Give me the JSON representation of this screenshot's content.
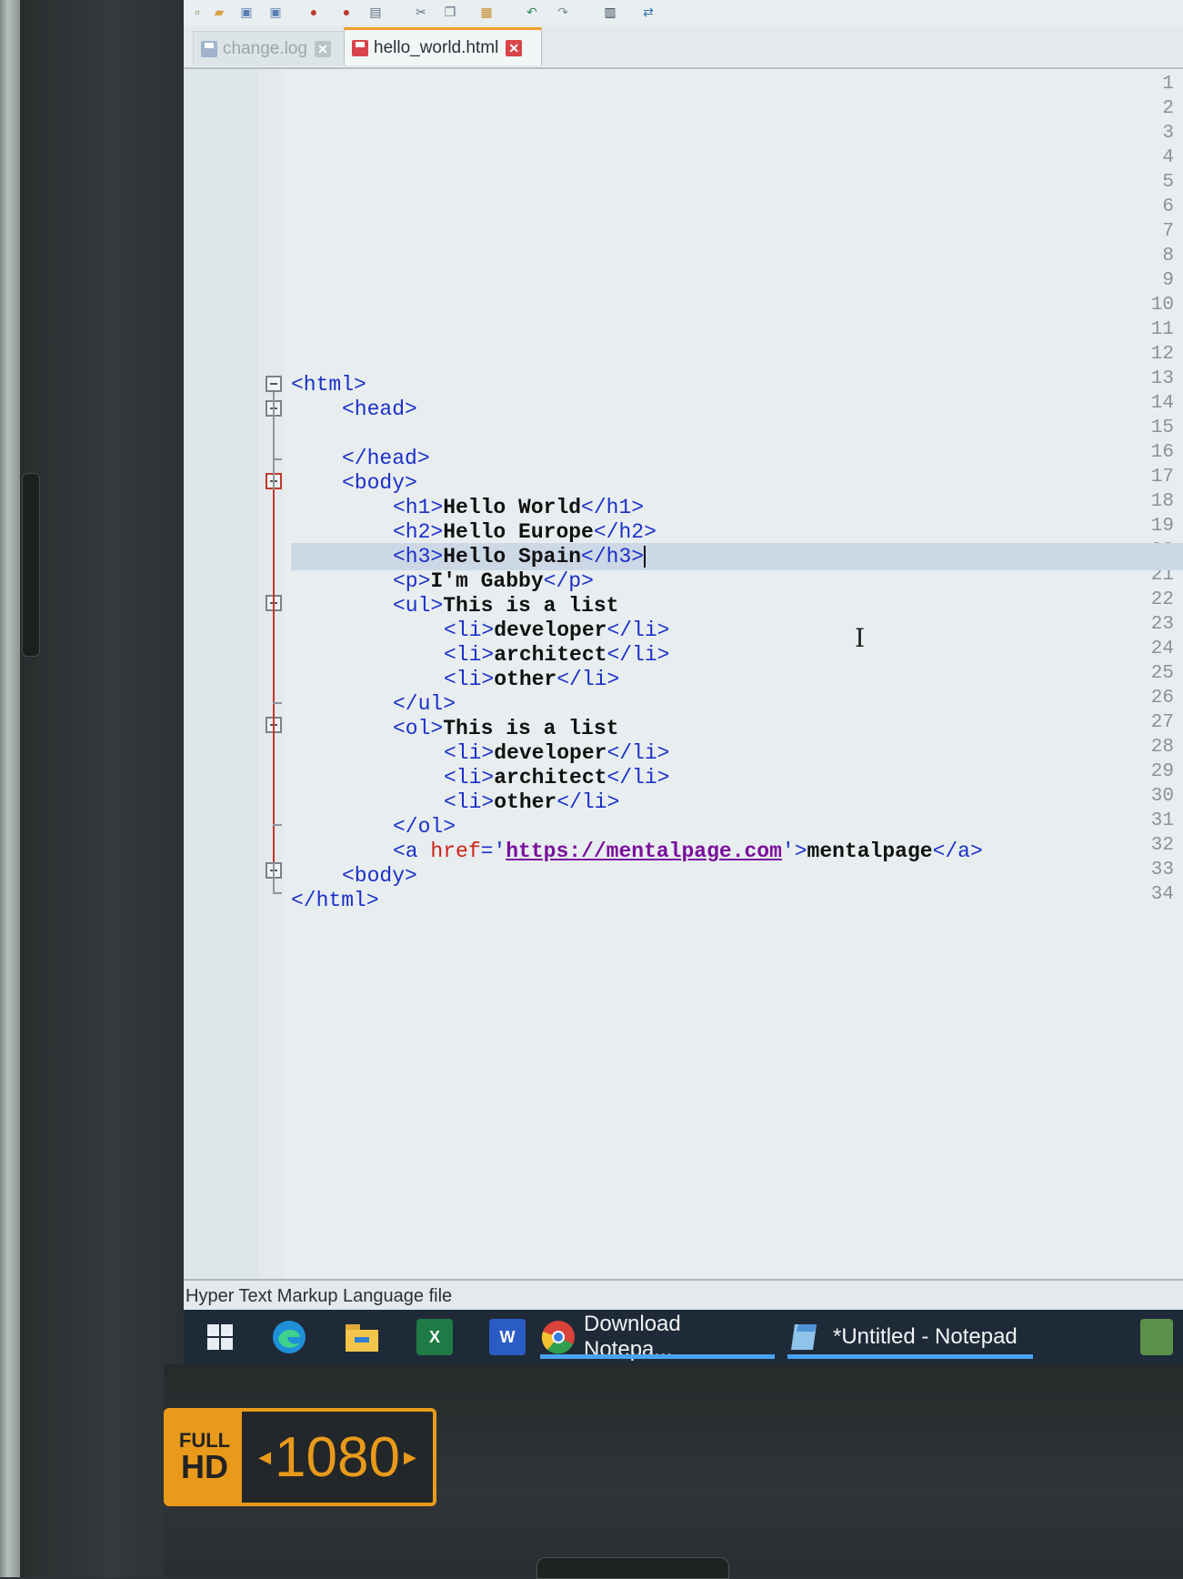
{
  "tabs": [
    {
      "label": "change.log",
      "active": false
    },
    {
      "label": "hello_world.html",
      "active": true
    }
  ],
  "editor": {
    "line_numbers": [
      "1",
      "2",
      "3",
      "4",
      "5",
      "6",
      "7",
      "8",
      "9",
      "10",
      "11",
      "12",
      "13",
      "14",
      "15",
      "16",
      "17",
      "18",
      "19",
      "20",
      "21",
      "22",
      "23",
      "24",
      "25",
      "26",
      "27",
      "28",
      "29",
      "30",
      "31",
      "32",
      "33",
      "34"
    ],
    "current_line": "20",
    "code": {
      "l13": {
        "t1": "<html>"
      },
      "l14": {
        "t1": "<head>"
      },
      "l16": {
        "t1": "</head>"
      },
      "l17": {
        "t1": "<body>"
      },
      "l18": {
        "t1": "<h1>",
        "x1": "Hello World",
        "t2": "</h1>"
      },
      "l19": {
        "t1": "<h2>",
        "x1": "Hello Europe",
        "t2": "</h2>"
      },
      "l20": {
        "t1": "<h3>",
        "x1": "Hello Spain",
        "t2": "</h3>"
      },
      "l21": {
        "t1": "<p>",
        "x1": "I'm Gabby",
        "t2": "</p>"
      },
      "l22": {
        "t1": "<ul>",
        "x1": "This is a list"
      },
      "l23": {
        "t1": "<li>",
        "x1": "developer",
        "t2": "</li>"
      },
      "l24": {
        "t1": "<li>",
        "x1": "architect",
        "t2": "</li>"
      },
      "l25": {
        "t1": "<li>",
        "x1": "other",
        "t2": "</li>"
      },
      "l26": {
        "t1": "</ul>"
      },
      "l27": {
        "t1": "<ol>",
        "x1": "This is a list"
      },
      "l28": {
        "t1": "<li>",
        "x1": "developer",
        "t2": "</li>"
      },
      "l29": {
        "t1": "<li>",
        "x1": "architect",
        "t2": "</li>"
      },
      "l30": {
        "t1": "<li>",
        "x1": "other",
        "t2": "</li>"
      },
      "l31": {
        "t1": "</ol>"
      },
      "l32": {
        "t1": "<a ",
        "attr": "href",
        "eq": "='",
        "url": "https://mentalpage.com",
        "q": "'",
        "t2": ">",
        "x1": "mentalpage",
        "t3": "</a>"
      },
      "l33": {
        "t1": "<body>"
      },
      "l34": {
        "t1": "</html>"
      }
    }
  },
  "statusbar": {
    "file_type": "Hyper Text Markup Language file"
  },
  "taskbar": {
    "items": [
      {
        "label": "Download Notepa..."
      },
      {
        "label": "*Untitled - Notepad"
      }
    ],
    "excel_letter": "X",
    "word_letter": "W"
  },
  "badge": {
    "full": "FULL",
    "hd": "HD",
    "resolution": "1080"
  },
  "colors": {
    "tag": "#1b2fc8",
    "attribute": "#d2201a",
    "text": "#111111",
    "string": "#7a0f9c",
    "tab_accent": "#f0a02a",
    "taskbar": "#1f2a38",
    "badge": "#e99a1a"
  },
  "icons": {
    "toolbar": [
      "new-file-icon",
      "open-folder-icon",
      "save-icon",
      "save-all-icon",
      "close-icon",
      "close-all-icon",
      "print-icon",
      "cut-icon",
      "copy-icon",
      "paste-icon",
      "undo-icon",
      "redo-icon",
      "find-icon",
      "replace-icon"
    ],
    "taskbar": [
      "windows-start-icon",
      "edge-icon",
      "file-explorer-icon",
      "excel-icon",
      "word-icon",
      "chrome-icon",
      "notepad-icon"
    ]
  }
}
